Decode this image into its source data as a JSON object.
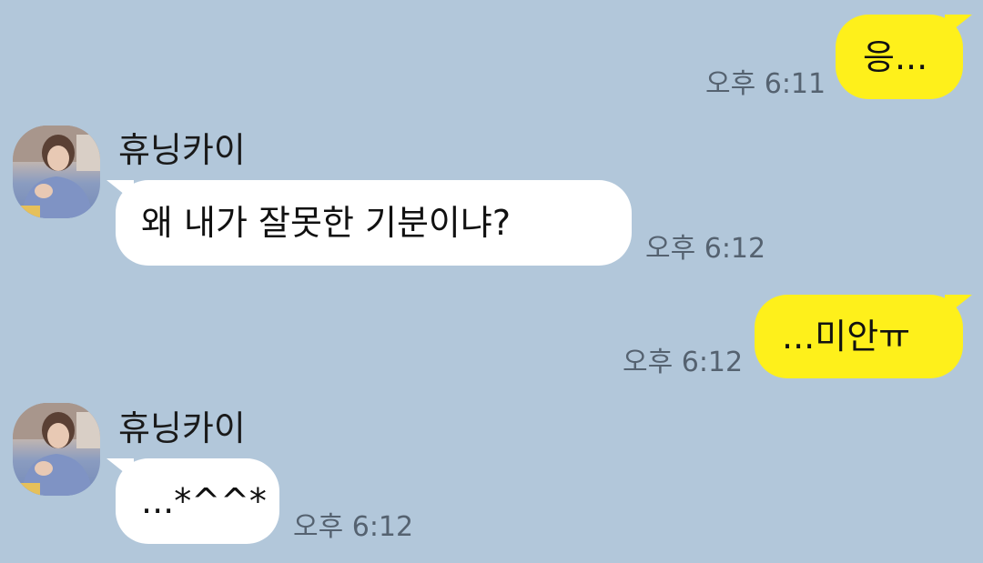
{
  "messages": [
    {
      "side": "out",
      "text": "응...",
      "time": "오후 6:11"
    },
    {
      "side": "in",
      "sender": "휴닝카이",
      "text": "왜 내가 잘못한 기분이냐?",
      "time": "오후 6:12"
    },
    {
      "side": "out",
      "text": "...미안ㅠ",
      "time": "오후 6:12"
    },
    {
      "side": "in",
      "sender": "휴닝카이",
      "text": "...*^^*",
      "time": "오후 6:12"
    }
  ],
  "colors": {
    "background": "#b2c7da",
    "outgoing_bubble": "#fef01b",
    "incoming_bubble": "#ffffff",
    "timestamp": "#556270"
  },
  "avatar": {
    "icon": "profile-photo"
  }
}
